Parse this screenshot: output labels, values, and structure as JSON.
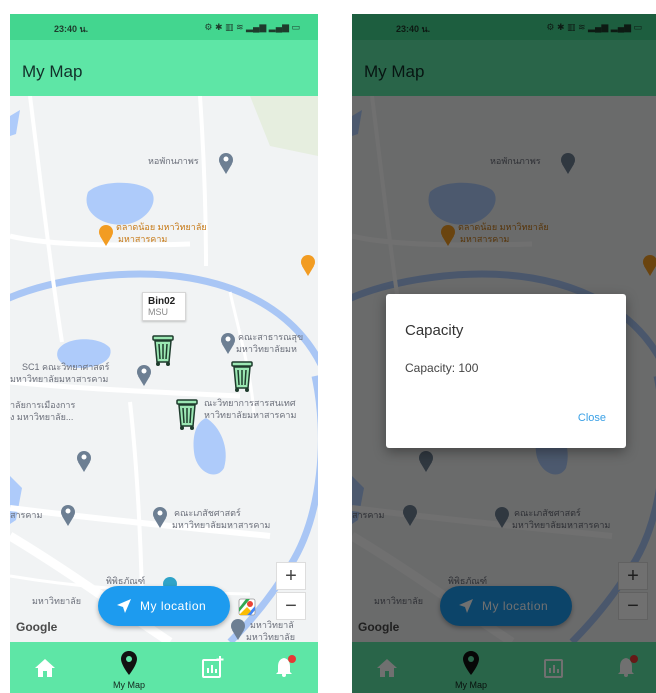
{
  "status": {
    "time": "23:40 น.",
    "icons": "⚙ ✱ ▥ ≋ ▂▄▆ ▂▄▆ ▭"
  },
  "appbar": {
    "title": "My Map"
  },
  "map": {
    "labels": {
      "dorm": "หอพักนภาพร",
      "market_line1": "ตลาดน้อย มหาวิทยาลัย",
      "market_line2": "มหาสารคาม",
      "public_health_line1": "คณะสาธารณสุข",
      "public_health_line2": "มหาวิทยาลัยมห",
      "sc1_line1": "SC1 คณะวิทยาศาสตร์",
      "sc1_line2": "มหาวิทยาลัยมหาสารคาม",
      "politics_line1": "าลัยการเมืองการ",
      "politics_line2": "ง มหาวิทยาลัย...",
      "it_line1": "ณะวิทยาการสารสนเทศ",
      "it_line2": "หาวิทยาลัยมหาสารคาม",
      "arts_line1": "คณะเภสัชศาสตร์",
      "arts_line2": "มหาวิทยาลัยมหาสารคาม",
      "sarakham_left": "สารคาม",
      "museum": "พิพิธภัณฑ์",
      "university_bottom": "มหาวิทยาลัย",
      "bottom_right_line1": "มหาวิทยาลั",
      "bottom_right_line2": "มหาวิทยาลัย"
    },
    "marker_tooltip": {
      "name": "Bin02",
      "subtitle": "MSU"
    },
    "zoom_in": "+",
    "zoom_out": "−",
    "my_location": "My location",
    "attribution": "Google"
  },
  "nav": {
    "my_map": "My Map"
  },
  "dialog": {
    "title": "Capacity",
    "body": "Capacity: 100",
    "close": "Close"
  },
  "colors": {
    "status": "#43d68f",
    "appbar": "#5ee6a6",
    "accent": "#1d9bef",
    "water": "#aecbfa",
    "road": "#ffffff"
  }
}
